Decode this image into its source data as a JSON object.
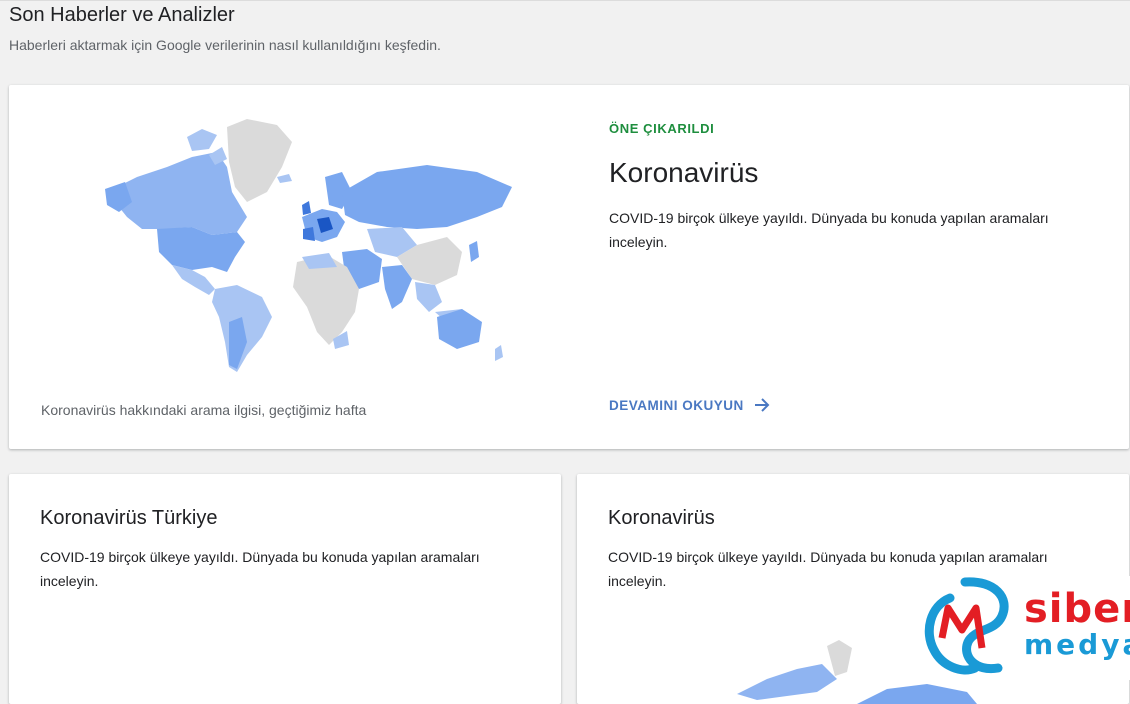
{
  "header": {
    "title": "Son Haberler ve Analizler",
    "subtitle": "Haberleri aktarmak için Google verilerinin nasıl kullanıldığını keşfedin."
  },
  "featured": {
    "label": "ÖNE ÇIKARILDI",
    "title": "Koronavirüs",
    "description": "COVID-19 birçok ülkeye yayıldı. Dünyada bu konuda yapılan aramaları inceleyin.",
    "read_more": "DEVAMINI OKUYUN",
    "map_caption": "Koronavirüs hakkındaki arama ilgisi, geçtiğimiz hafta",
    "map_icon": "world-map-icon",
    "arrow_icon": "arrow-right-icon"
  },
  "cards": [
    {
      "title": "Koronavirüs Türkiye",
      "description": "COVID-19 birçok ülkeye yayıldı. Dünyada bu konuda yapılan aramaları inceleyin."
    },
    {
      "title": "Koronavirüs",
      "description": "COVID-19 birçok ülkeye yayıldı. Dünyada bu konuda yapılan aramaları inceleyin."
    }
  ],
  "watermark": {
    "line1": "siber",
    "line2": "medya"
  },
  "colors": {
    "map_light": "#a9c5f3",
    "map_medium": "#7aa7ef",
    "map_dark": "#1a56c4",
    "map_grey": "#dadada",
    "accent_green": "#1e8e3e",
    "link_blue": "#4a78c2"
  }
}
